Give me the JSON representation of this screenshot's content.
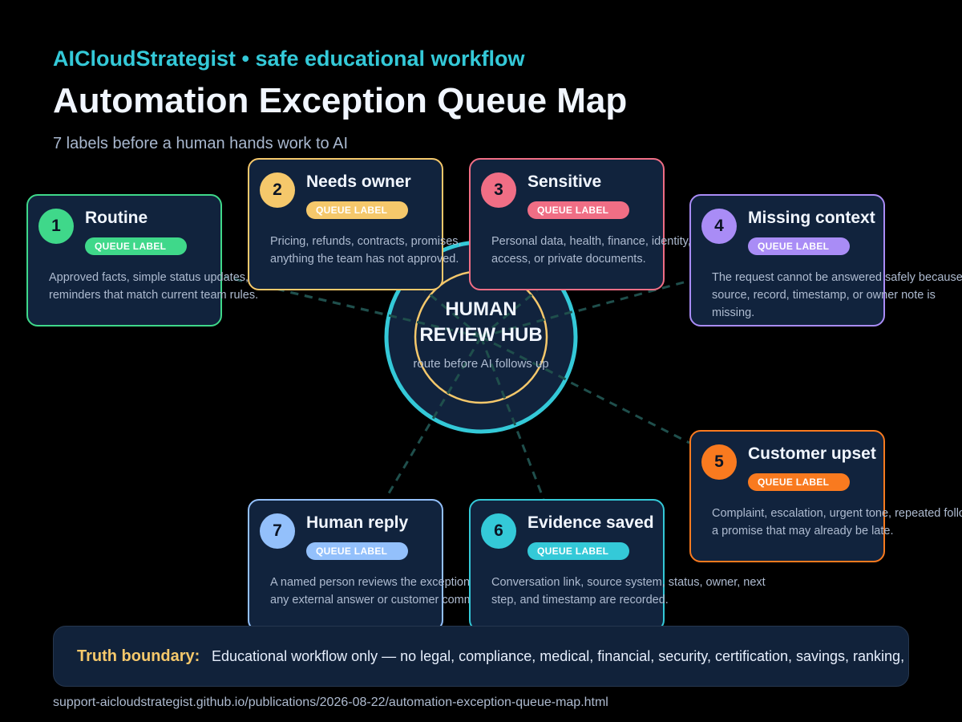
{
  "header": {
    "kicker": "AICloudStrategist • safe educational workflow",
    "title": "Automation Exception Queue Map",
    "subtitle": "7 labels before a human hands work to AI"
  },
  "hub": {
    "title_line1": "HUMAN",
    "title_line2": "REVIEW HUB",
    "subtitle": "route before AI follows up",
    "outer_ring_color": "#34c9d8",
    "inner_ring_color": "#f5c86b"
  },
  "cards": [
    {
      "number": "1",
      "title": "Routine",
      "badge": "QUEUE LABEL",
      "desc_lines": [
        "Approved facts, simple status updates,",
        "reminders that match current team rules."
      ],
      "color": "#3fd88a"
    },
    {
      "number": "2",
      "title": "Needs owner",
      "badge": "QUEUE LABEL",
      "desc_lines": [
        "Pricing, refunds, contracts, promises,",
        "anything the team has not approved."
      ],
      "color": "#f5c86b"
    },
    {
      "number": "3",
      "title": "Sensitive",
      "badge": "QUEUE LABEL",
      "desc_lines": [
        "Personal data, health, finance, identity,",
        "access, or private documents."
      ],
      "color": "#f06e85"
    },
    {
      "number": "4",
      "title": "Missing context",
      "badge": "QUEUE LABEL",
      "desc_lines": [
        "The request cannot be answered safely because a",
        "source, record, timestamp, or owner note is",
        "missing."
      ],
      "color": "#a98cf6"
    },
    {
      "number": "5",
      "title": "Customer upset",
      "badge": "QUEUE LABEL",
      "desc_lines": [
        "Complaint, escalation, urgent tone, repeated follow-up, or",
        "a promise that may already be late."
      ],
      "color": "#f97a1f"
    },
    {
      "number": "6",
      "title": "Evidence saved",
      "badge": "QUEUE LABEL",
      "desc_lines": [
        "Conversation link, source system, status, owner, next",
        "step, and timestamp are recorded."
      ],
      "color": "#34c9d8"
    },
    {
      "number": "7",
      "title": "Human reply",
      "badge": "QUEUE LABEL",
      "desc_lines": [
        "A named person reviews the exception before",
        "any external answer or customer commitment."
      ],
      "color": "#93c0fb"
    }
  ],
  "footer": {
    "truth_label": "Truth boundary:",
    "truth_text": "Educational workflow only — no legal, compliance, medical, financial, security, certification, savings, ranking, revenue, or outcome guarantee.",
    "url": "support-aicloudstrategist.github.io/publications/2026-08-22/automation-exception-queue-map.html"
  },
  "colors": {
    "background": "#000000",
    "card_fill": "#11233d",
    "connector": "#1f4f4c"
  }
}
